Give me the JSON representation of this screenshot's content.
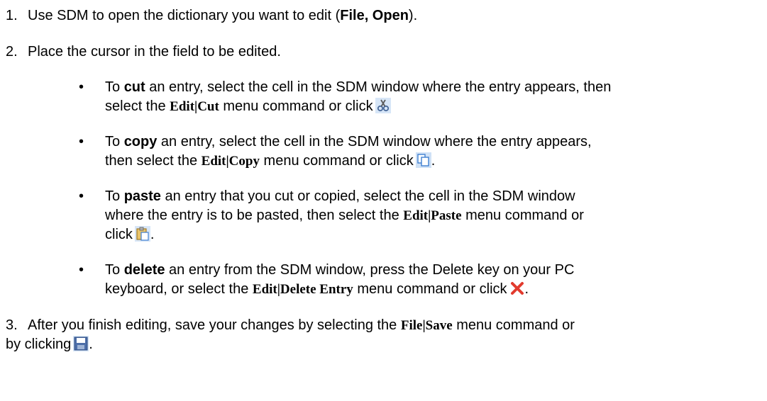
{
  "steps": [
    {
      "number": "1.",
      "pre": "Use SDM to open the dictionary you want to edit (",
      "bold": "File, Open",
      "post": ")."
    },
    {
      "number": "2.",
      "text": "Place the cursor in the field to be edited."
    },
    {
      "number": "3.",
      "pre": "After you finish editing, save your changes by selecting the ",
      "cmd": "File|Save",
      "post": " menu command or",
      "line2": "by clicking",
      "end": "."
    }
  ],
  "bullet_glyph": "•",
  "bullets": [
    {
      "l1_pre": "To ",
      "l1_bold": "cut",
      "l1_post": " an entry, select the cell in the SDM window where the entry appears, then",
      "l2_pre": "select the ",
      "l2_cmd": "Edit|Cut",
      "l2_post": " menu command or click",
      "icon": "cut-icon"
    },
    {
      "l1_pre": "To ",
      "l1_bold": "copy",
      "l1_post": " an entry, select the cell in the SDM window where the entry appears,",
      "l2_pre": "then select the ",
      "l2_cmd": "Edit|Copy",
      "l2_post": " menu command or click",
      "l2_end": ".",
      "icon": "copy-icon"
    },
    {
      "l1_pre": "To ",
      "l1_bold": "paste",
      "l1_post": " an entry that you cut or copied, select the cell in the SDM window",
      "l2_pre": "where the entry is to be pasted, then select the ",
      "l2_cmd": "Edit|Paste",
      "l2_post": " menu command or",
      "l3": "click",
      "l3_end": ".",
      "icon": "paste-icon"
    },
    {
      "l1_pre": "To ",
      "l1_bold": "delete",
      "l1_post": " an entry from the SDM window, press the Delete key on your PC",
      "l2_pre": "keyboard, or select the ",
      "l2_cmd": "Edit|Delete Entry",
      "l2_post": " menu command or click",
      "l2_end": ".",
      "icon": "delete-icon"
    }
  ],
  "icons": {
    "cut": "cut-icon",
    "copy": "copy-icon",
    "paste": "paste-icon",
    "delete": "delete-icon",
    "save": "save-icon"
  },
  "colors": {
    "delete_icon": "#e23b2e",
    "icon_blue": "#3f7fd0"
  }
}
